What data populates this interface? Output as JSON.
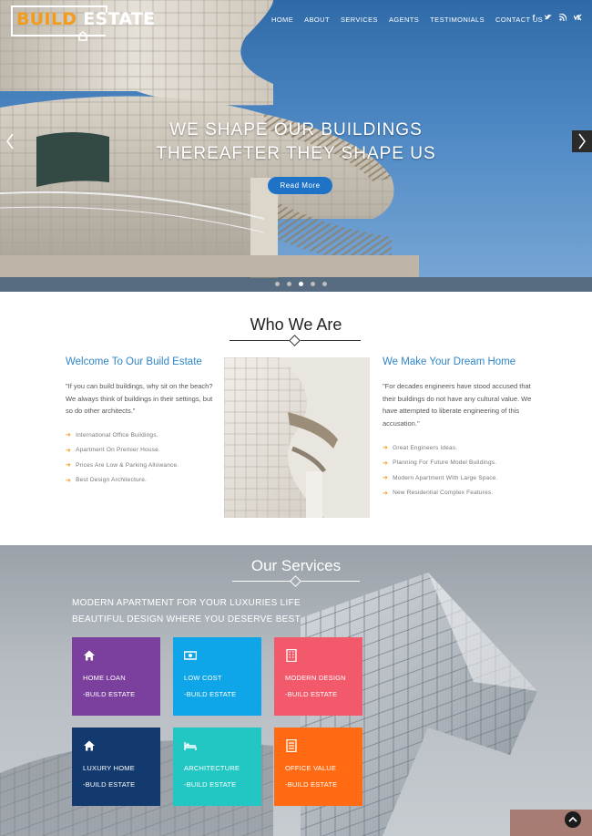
{
  "logo": {
    "part1": "BUILD",
    "part2": "ESTATE"
  },
  "nav": [
    "HOME",
    "ABOUT",
    "SERVICES",
    "AGENTS",
    "TESTIMONIALS",
    "CONTACT US"
  ],
  "social": [
    "f",
    "t",
    "rss",
    "vk"
  ],
  "hero": {
    "line1": "WE SHAPE OUR BUILDINGS",
    "line2": "THEREAFTER THEY SHAPE US",
    "button": "Read More",
    "active_slide": 3,
    "slide_count": 5
  },
  "who": {
    "title": "Who We Are",
    "left": {
      "heading": "Welcome To Our Build Estate",
      "para": "\"If you can build buildings, why sit on the beach?We always think of buildings in their settings, but so do other architects.\"",
      "items": [
        "International Office Buildings.",
        "Apartment On Premier House.",
        "Prices Are Low & Parking Allowance.",
        "Best Design Architecture."
      ]
    },
    "right": {
      "heading": "We Make Your Dream Home",
      "para": "\"For decades engineers have stood accused that their buildings do not have any cultural value. We have attempted to liberate engineering of this accusation.\"",
      "items": [
        "Great Engineers Ideas.",
        "Planning For Future Model Buildings.",
        "Modern Apartment With Large Space.",
        "New Residential Complex Features."
      ]
    }
  },
  "services": {
    "title": "Our Services",
    "tagline1": "MODERN APARTMENT FOR YOUR LUXURIES LIFE",
    "tagline2": "BEAUTIFUL DESIGN WHERE YOU DESERVE BEST",
    "cards": [
      {
        "title": "HOME LOAN",
        "sub": "-BUILD ESTATE",
        "color": "#7b3f9d",
        "icon": "home-icon"
      },
      {
        "title": "LOW COST",
        "sub": "-BUILD ESTATE",
        "color": "#0ea5e9",
        "icon": "money-icon"
      },
      {
        "title": "MODERN DESIGN",
        "sub": "-BUILD ESTATE",
        "color": "#f25a6b",
        "icon": "building-icon"
      },
      {
        "title": "LUXURY HOME",
        "sub": "-BUILD ESTATE",
        "color": "#123a6e",
        "icon": "home-icon"
      },
      {
        "title": "ARCHITECTURE",
        "sub": "-BUILD ESTATE",
        "color": "#22c7c3",
        "icon": "bed-icon"
      },
      {
        "title": "OFFICE VALUE",
        "sub": "-BUILD ESTATE",
        "color": "#ff6a13",
        "icon": "document-icon"
      }
    ]
  },
  "colors": {
    "accent_orange": "#f39b1c",
    "accent_blue": "#2f86c6",
    "button_blue": "#1f73c6"
  }
}
